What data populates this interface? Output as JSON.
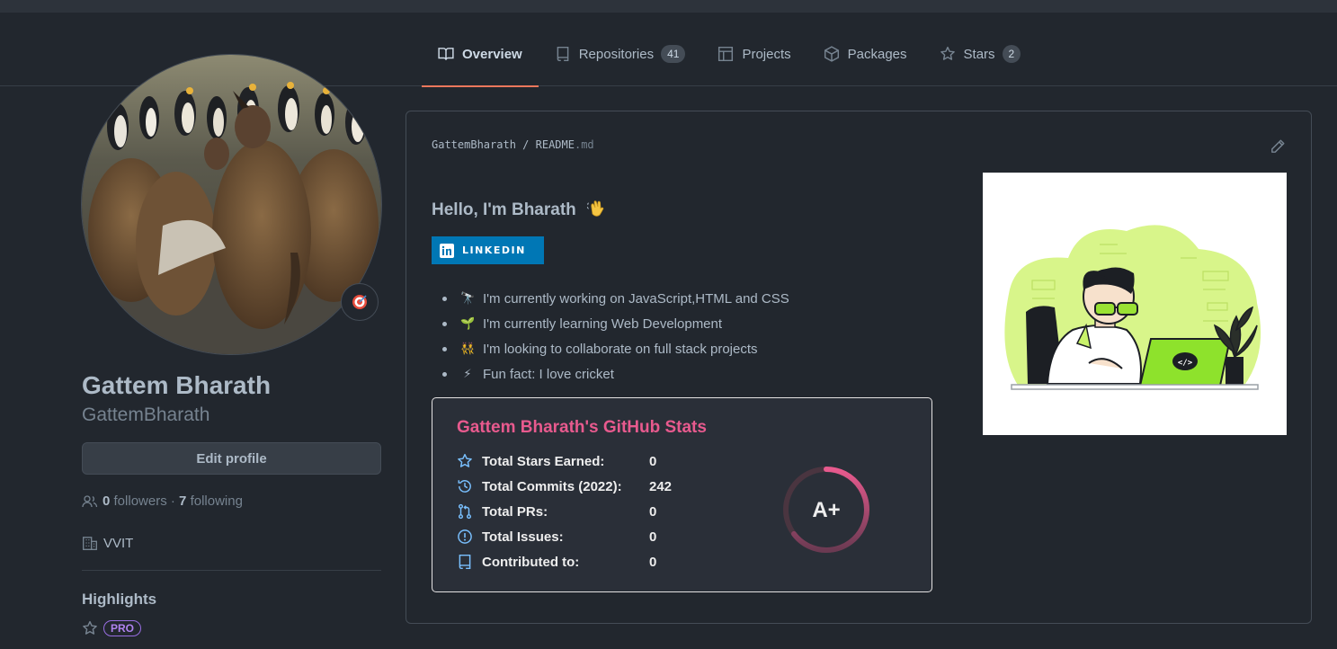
{
  "tabs": [
    {
      "label": "Overview",
      "icon": "book-icon"
    },
    {
      "label": "Repositories",
      "count": "41",
      "icon": "repo-icon"
    },
    {
      "label": "Projects",
      "icon": "table-icon"
    },
    {
      "label": "Packages",
      "icon": "package-icon"
    },
    {
      "label": "Stars",
      "count": "2",
      "icon": "star-icon"
    }
  ],
  "profile": {
    "name": "Gattem Bharath",
    "login": "GattemBharath",
    "edit_label": "Edit profile",
    "followers_count": "0",
    "followers_label": "followers",
    "separator": "·",
    "following_count": "7",
    "following_label": "following",
    "organization": "VVIT",
    "highlights_title": "Highlights",
    "pro_badge": "PRO"
  },
  "readme": {
    "owner": "GattemBharath",
    "slash": "/",
    "file": "README",
    "ext": ".md",
    "heading": "Hello, I'm Bharath",
    "linkedin_label": "LINKEDIN",
    "bullets": [
      {
        "emoji": "🔭",
        "text": "I'm currently working on JavaScript,HTML and CSS"
      },
      {
        "emoji": "🌱",
        "text": "I'm currently learning Web Development"
      },
      {
        "emoji": "👯",
        "text": "I'm looking to collaborate on full stack projects"
      },
      {
        "emoji": "⚡",
        "text": "Fun fact: I love cricket"
      }
    ]
  },
  "stats": {
    "title": "Gattem Bharath's GitHub Stats",
    "rows": [
      {
        "label": "Total Stars Earned:",
        "value": "0"
      },
      {
        "label": "Total Commits (2022):",
        "value": "242"
      },
      {
        "label": "Total PRs:",
        "value": "0"
      },
      {
        "label": "Total Issues:",
        "value": "0"
      },
      {
        "label": "Contributed to:",
        "value": "0"
      }
    ],
    "grade": "A+"
  },
  "colors": {
    "accent_tab": "#ec775c",
    "stats_title": "#e85a8e",
    "linkedin": "#0077b5",
    "illustration_accent": "#c9f26b"
  }
}
